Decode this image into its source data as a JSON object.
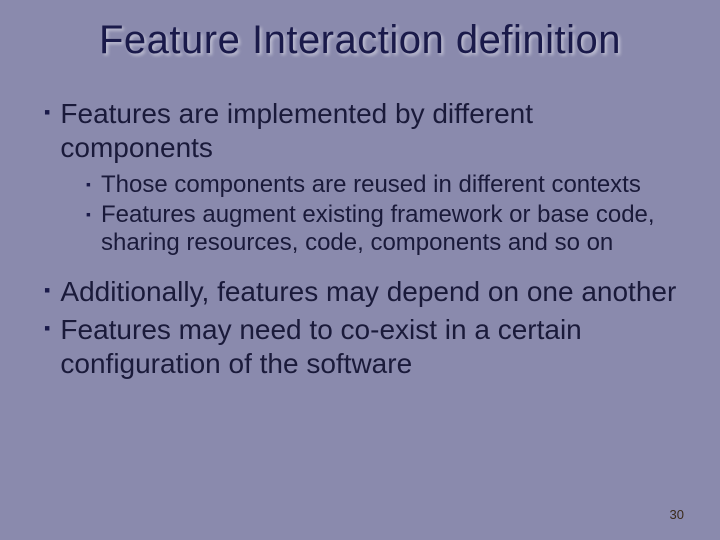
{
  "title": "Feature Interaction definition",
  "bullets": {
    "b0": "Features are implemented by different components",
    "b0_sub0": "Those components are reused in different contexts",
    "b0_sub1": "Features augment existing framework or base code, sharing resources, code, components and so on",
    "b1": "Additionally, features may depend on one another",
    "b2": "Features may need to co-exist in a certain configuration of the software"
  },
  "page_number": "30"
}
